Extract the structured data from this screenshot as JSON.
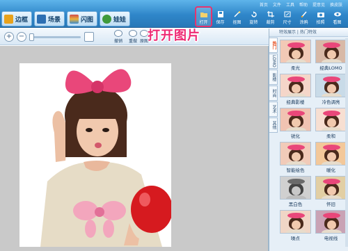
{
  "top_menu": [
    "首页",
    "文件",
    "工具",
    "帮助",
    "提意见",
    "换皮肤"
  ],
  "tabs": [
    {
      "label": "边框",
      "icon": "frame-icon",
      "color": "#e8a21c"
    },
    {
      "label": "场景",
      "icon": "scene-icon",
      "color": "#2d6fb3"
    },
    {
      "label": "闪图",
      "icon": "flash-icon",
      "color": "#8c4ab0"
    },
    {
      "label": "娃娃",
      "icon": "doll-icon",
      "color": "#3f9a3c"
    }
  ],
  "tools": [
    {
      "label": "打开",
      "icon": "folder-open-icon"
    },
    {
      "label": "保存",
      "icon": "save-icon"
    },
    {
      "label": "抠图",
      "icon": "magic-wand-icon"
    },
    {
      "label": "旋转",
      "icon": "rotate-icon"
    },
    {
      "label": "裁剪",
      "icon": "crop-icon"
    },
    {
      "label": "尺寸",
      "icon": "resize-icon"
    },
    {
      "label": "涂鸦",
      "icon": "brush-icon"
    },
    {
      "label": "拍照",
      "icon": "camera-icon"
    },
    {
      "label": "看图",
      "icon": "eye-icon"
    }
  ],
  "subtools": [
    "撤销",
    "重做",
    "原图"
  ],
  "callout": "打开图片",
  "panel": {
    "header": "特效展示 | 热门特效",
    "vtabs": [
      "热门",
      "LOMO",
      "影楼",
      "时尚",
      "艺术",
      "其他"
    ],
    "selected_vtab": 0,
    "effects": [
      {
        "label": "柔光",
        "tint": "#f2c9b6"
      },
      {
        "label": "经典LOMO",
        "tint": "#d8b9a7"
      },
      {
        "label": "经典影楼",
        "tint": "#f5d6c9"
      },
      {
        "label": "冷色调亮",
        "tint": "#c9dbe8"
      },
      {
        "label": "锐化",
        "tint": "#f1c3b2"
      },
      {
        "label": "柔和",
        "tint": "#f7dfd2"
      },
      {
        "label": "智能绘色",
        "tint": "#f1cbb9"
      },
      {
        "label": "暖化",
        "tint": "#f3c89a"
      },
      {
        "label": "黑白色",
        "tint": "#d0d0d0"
      },
      {
        "label": "怀旧",
        "tint": "#e2cfa4"
      },
      {
        "label": "噪点",
        "tint": "#f0d6c6"
      },
      {
        "label": "电视线",
        "tint": "#c9a3b5"
      }
    ]
  },
  "colors": {
    "accent": "#ee2a74",
    "titlebar": "#2f86c9"
  }
}
